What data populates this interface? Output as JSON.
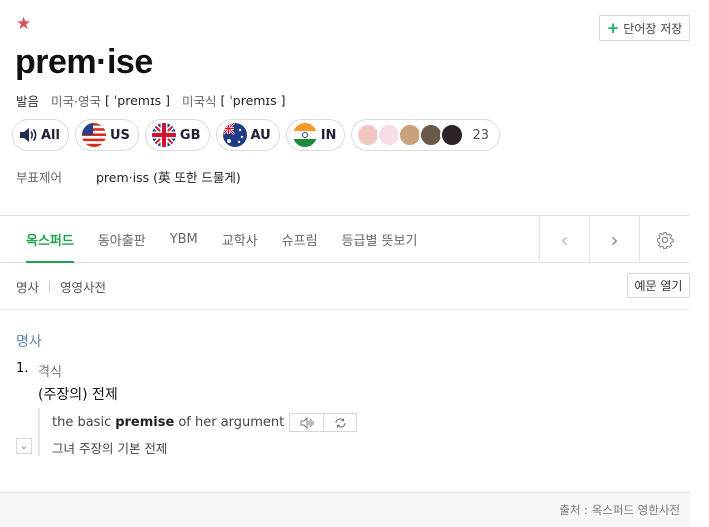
{
  "entry": {
    "star_icon": "★",
    "headword": "prem·ise",
    "save_button": {
      "plus": "+",
      "label": "단어장 저장"
    }
  },
  "pronunciation": {
    "label": "발음",
    "items": [
      {
        "region": "미국·영국",
        "ipa": "[ ˈpremɪs ]"
      },
      {
        "region": "미국식",
        "ipa": "[ ˈpremɪs ]"
      }
    ]
  },
  "audio_chips": [
    {
      "label": "All",
      "icon": "speaker-icon"
    },
    {
      "label": "US",
      "icon": "us-flag-icon"
    },
    {
      "label": "GB",
      "icon": "gb-flag-icon"
    },
    {
      "label": "AU",
      "icon": "au-flag-icon"
    },
    {
      "label": "IN",
      "icon": "in-flag-icon"
    }
  ],
  "user_recordings": {
    "count": "23"
  },
  "variant": {
    "label": "부표제어",
    "value": "prem·iss (英 또한 드물게)"
  },
  "tabs": [
    {
      "label": "옥스퍼드",
      "active": true
    },
    {
      "label": "동아출판",
      "active": false
    },
    {
      "label": "YBM",
      "active": false
    },
    {
      "label": "교학사",
      "active": false
    },
    {
      "label": "슈프림",
      "active": false
    },
    {
      "label": "등급별 뜻보기",
      "active": false
    }
  ],
  "tab_controls": {
    "prev": "‹",
    "next": "›",
    "settings_icon": "gear-icon"
  },
  "pos_filters": {
    "noun": "명사",
    "english": "영영사전"
  },
  "example_toggle": "예문 열기",
  "senses": {
    "pos": "명사",
    "items": [
      {
        "number": "1.",
        "register": "격식",
        "definition": "(주장의) 전제",
        "example": {
          "before": "the basic",
          "bold": "premise",
          "after": "of her argument",
          "translation": "그녀 주장의 기본 전제",
          "chevron": "⌄"
        }
      }
    ]
  },
  "footer": {
    "source": "출처 : 옥스퍼드 영한사전"
  },
  "colors": {
    "accent": "#1fa24f",
    "pos_blue": "#5c86b3",
    "star": "#d9534f"
  }
}
